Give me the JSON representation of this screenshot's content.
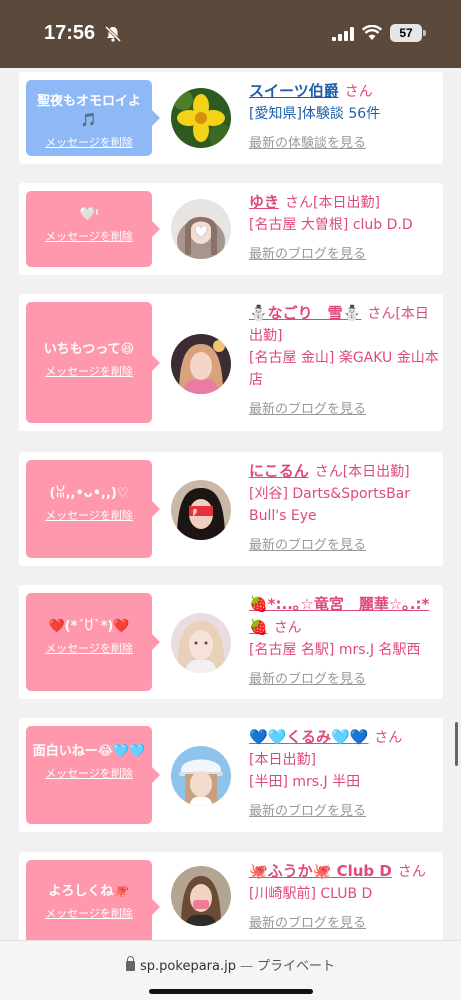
{
  "status": {
    "time": "17:56",
    "battery": "57"
  },
  "cards": [
    {
      "bubble_color": "#8fb8f6",
      "bubble_msg": "聖夜もオモロイよ🎵",
      "delete_label": "メッセージを削除",
      "avatar_kind": "flower",
      "name": "スイーツ伯爵",
      "san": "さん",
      "tag": "",
      "detail_1": "[愛知県]体験談 56件",
      "detail_2": "",
      "more": "最新の体験談を見る"
    },
    {
      "bubble_color": "#ff98ac",
      "bubble_msg": "🤍ᵎ",
      "delete_label": "メッセージを削除",
      "avatar_kind": "girl-1",
      "name": "ゆき",
      "san": "さん",
      "tag": "[本日出勤]",
      "detail_1": "[名古屋 大曽根] club D.D",
      "detail_2": "",
      "more": "最新のブログを見る"
    },
    {
      "bubble_color": "#ff98ac",
      "bubble_msg": "いちもつって😆",
      "delete_label": "メッセージを削除",
      "avatar_kind": "girl-2",
      "name": "⛄なごり　雪⛄",
      "san": "さん",
      "tag": "[本日出勤]",
      "detail_1": "[名古屋 金山] 楽GAKU 金山本店",
      "detail_2": "",
      "more": "最新のブログを見る"
    },
    {
      "bubble_color": "#ff98ac",
      "bubble_msg": "(ꈍ,,•ᴗ•,,)♡",
      "delete_label": "メッセージを削除",
      "avatar_kind": "girl-3",
      "name": "にこるん",
      "san": "さん",
      "tag": "[本日出勤]",
      "detail_1": "[刈谷] Darts&SportsBar Bull's Eye",
      "detail_2": "",
      "more": "最新のブログを見る"
    },
    {
      "bubble_color": "#ff98ac",
      "bubble_msg": "❤️(*´ꇴ`*)❤️",
      "delete_label": "メッセージを削除",
      "avatar_kind": "girl-4",
      "name": "🍓*:..｡☆竜宮　麗華☆｡.:*🍓",
      "san": "さん",
      "tag": "",
      "detail_1": "[名古屋 名駅] mrs.J 名駅西",
      "detail_2": "",
      "more": "最新のブログを見る"
    },
    {
      "bubble_color": "#ff98ac",
      "bubble_msg": "面白いねー😂🩵🩵",
      "delete_label": "メッセージを削除",
      "avatar_kind": "girl-5",
      "name": "💙🩵くるみ🩵💙",
      "san": "さん",
      "tag": "[本日出勤]",
      "detail_1": "[半田] mrs.J 半田",
      "detail_2": "",
      "more": "最新のブログを見る"
    },
    {
      "bubble_color": "#ff98ac",
      "bubble_msg": "よろしくね🐙",
      "delete_label": "メッセージを削除",
      "avatar_kind": "girl-6",
      "name": "🐙ふうか🐙 Club D",
      "san": "さん",
      "tag": "",
      "detail_1": "[川崎駅前] CLUB D",
      "detail_2": "",
      "more": "最新のブログを見る"
    }
  ],
  "browser": {
    "url": "sp.pokepara.jp",
    "separator": "—",
    "mode": "プライベート"
  }
}
